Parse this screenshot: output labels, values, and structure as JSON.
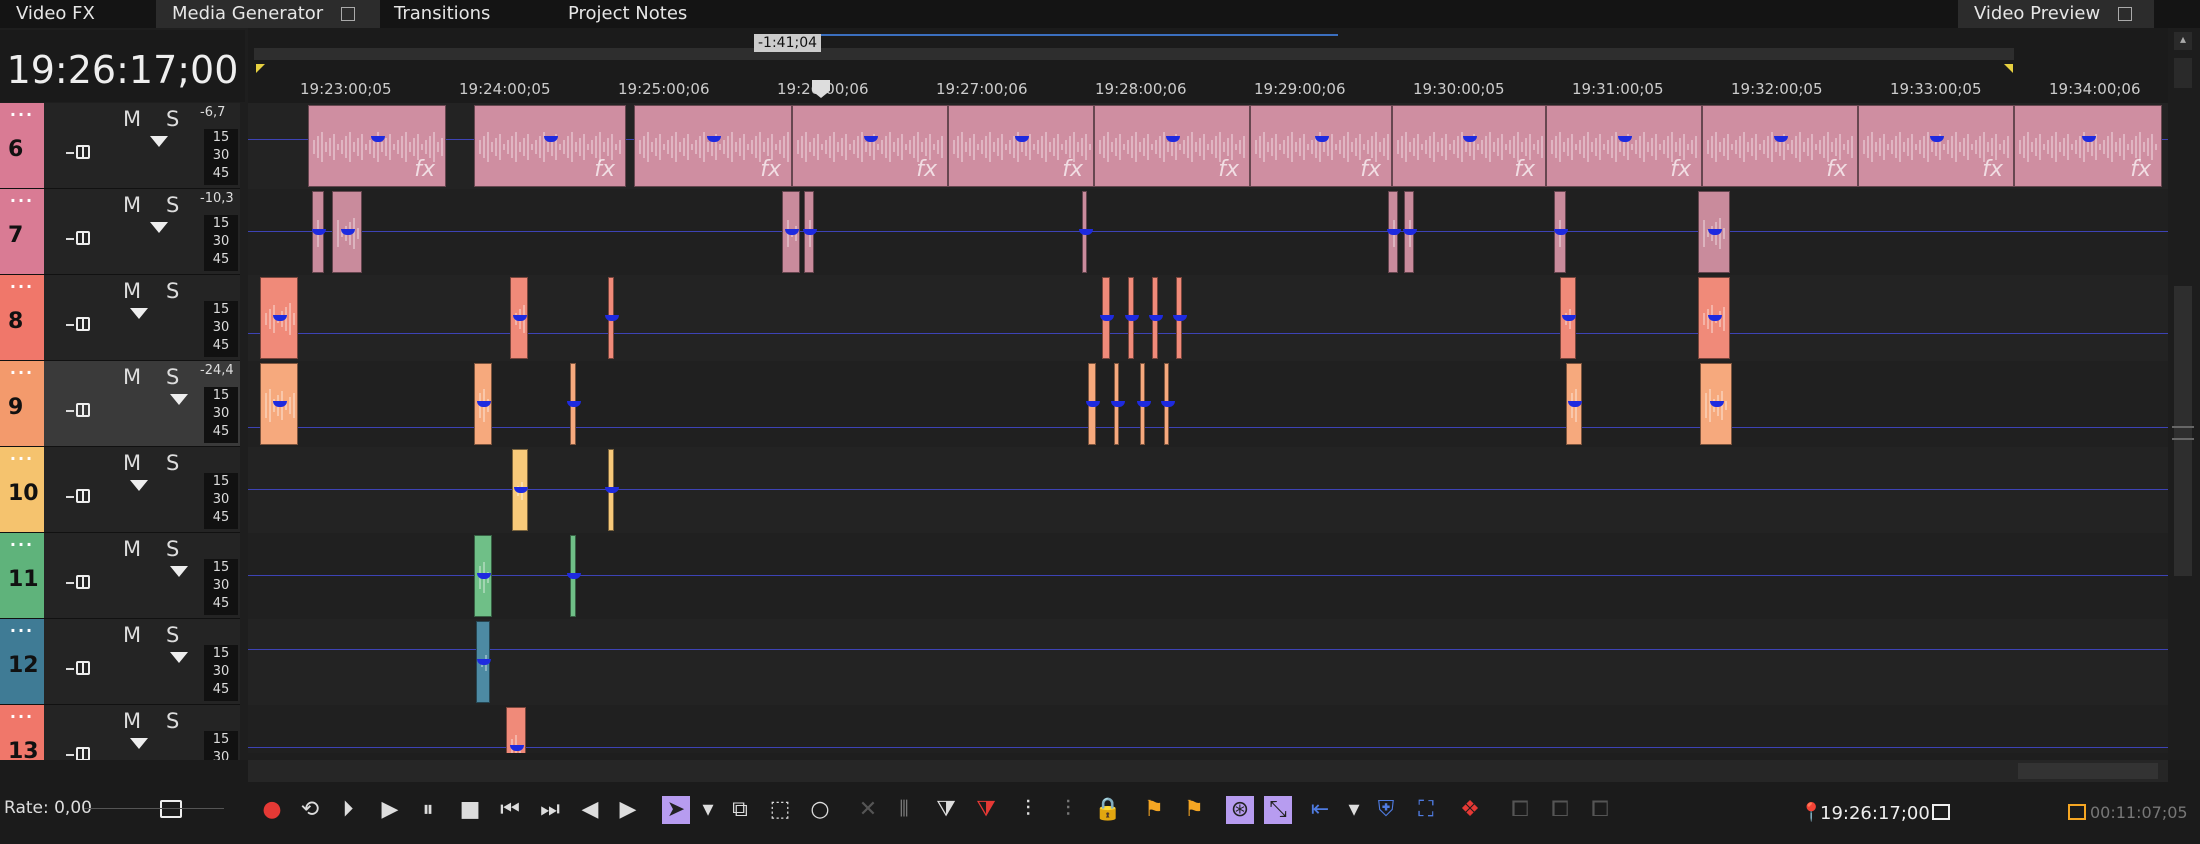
{
  "tabs": [
    {
      "label": "Video FX",
      "active": false
    },
    {
      "label": "Media Generator",
      "active": true
    },
    {
      "label": "Transitions",
      "active": false
    },
    {
      "label": "Project Notes",
      "active": false
    }
  ],
  "preview_tab": {
    "label": "Video Preview"
  },
  "timecode": "19:26:17;00",
  "cursor_label": "-1:41;04",
  "ruler_ticks": [
    "19:23:00;05",
    "19:24:00;05",
    "19:25:00;06",
    "19:26:00;06",
    "19:27:00;06",
    "19:28:00;06",
    "19:29:00;06",
    "19:30:00;05",
    "19:31:00;05",
    "19:32:00;05",
    "19:33:00;05",
    "19:34:00;06"
  ],
  "tracks": [
    {
      "num": "6",
      "color": "#d97b94",
      "meter": "-6,7",
      "selected": false
    },
    {
      "num": "7",
      "color": "#d97b94",
      "meter": "-10,3",
      "selected": false
    },
    {
      "num": "8",
      "color": "#f0776a",
      "meter": "",
      "selected": false
    },
    {
      "num": "9",
      "color": "#f39a6c",
      "meter": "-24,4",
      "selected": true
    },
    {
      "num": "10",
      "color": "#f5c36e",
      "meter": "",
      "selected": false
    },
    {
      "num": "11",
      "color": "#5fb37b",
      "meter": "",
      "selected": false
    },
    {
      "num": "12",
      "color": "#3f7b95",
      "meter": "",
      "selected": false
    },
    {
      "num": "13",
      "color": "#f0776a",
      "meter": "",
      "selected": false
    }
  ],
  "track_labels": {
    "mute": "M",
    "solo": "S",
    "scale": [
      "15",
      "30",
      "45"
    ]
  },
  "transport": {
    "rate_label": "Rate: 0,00",
    "position": "19:26:17;00",
    "length": "00:11:07;05"
  },
  "fx_label": "fx",
  "colors": {
    "accent_purple": "#b79cf0",
    "record_red": "#e53935",
    "marker_orange": "#f5a623"
  }
}
